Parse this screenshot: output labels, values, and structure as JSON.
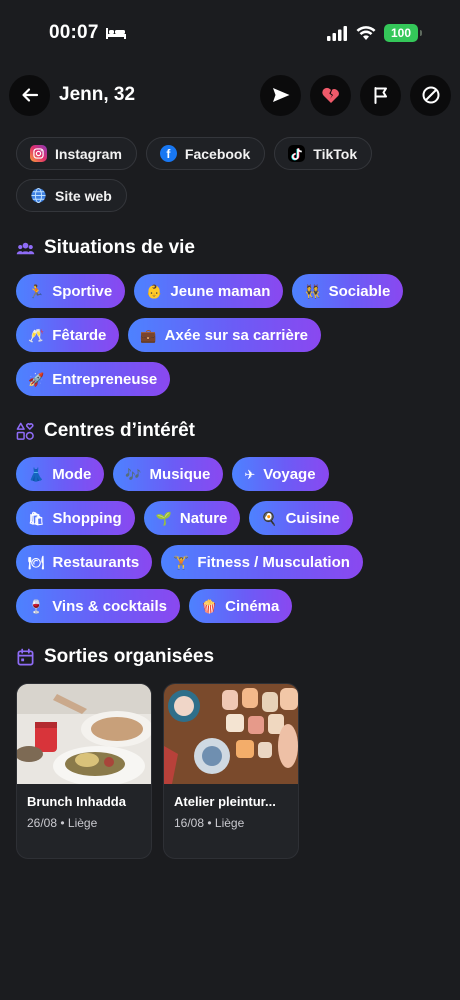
{
  "status": {
    "time": "00:07",
    "battery": "100"
  },
  "header": {
    "title": "Jenn, 32",
    "icons": [
      "arrow-left-icon",
      "send-icon",
      "broken-heart-icon",
      "flag-icon",
      "block-icon"
    ]
  },
  "socials": [
    {
      "label": "Instagram",
      "icon": "instagram-icon"
    },
    {
      "label": "Facebook",
      "icon": "facebook-icon"
    },
    {
      "label": "TikTok",
      "icon": "tiktok-icon"
    },
    {
      "label": "Site web",
      "icon": "globe-icon"
    }
  ],
  "life_situations": {
    "title": "Situations de vie",
    "chips": [
      {
        "emoji": "🏃",
        "label": "Sportive"
      },
      {
        "emoji": "👶",
        "label": "Jeune maman"
      },
      {
        "emoji": "👯",
        "label": "Sociable"
      },
      {
        "emoji": "🥂",
        "label": "Fêtarde"
      },
      {
        "emoji": "💼",
        "label": "Axée sur sa carrière"
      },
      {
        "emoji": "🚀",
        "label": "Entrepreneuse"
      }
    ]
  },
  "interests": {
    "title": "Centres d’intérêt",
    "chips": [
      {
        "emoji": "👗",
        "label": "Mode"
      },
      {
        "emoji": "🎶",
        "label": "Musique"
      },
      {
        "emoji": "✈",
        "label": "Voyage"
      },
      {
        "emoji": "🛍",
        "label": "Shopping"
      },
      {
        "emoji": "🌱",
        "label": "Nature"
      },
      {
        "emoji": "🍳",
        "label": "Cuisine"
      },
      {
        "emoji": "🍽",
        "label": "Restaurants"
      },
      {
        "emoji": "🏋",
        "label": "Fitness / Musculation"
      },
      {
        "emoji": "🍷",
        "label": "Vins & cocktails"
      },
      {
        "emoji": "🍿",
        "label": "Cinéma"
      }
    ]
  },
  "outings": {
    "title": "Sorties organisées",
    "cards": [
      {
        "name": "Brunch Inhadda",
        "meta": "26/08 • Liège"
      },
      {
        "name": "Atelier pleintur...",
        "meta": "16/08 • Liège"
      }
    ]
  },
  "colors": {
    "background": "#1b1c1f",
    "chip_start": "#4d82ff",
    "chip_end": "#8a48f0",
    "battery": "#34c759",
    "section_icon": "#8f6cf7"
  }
}
